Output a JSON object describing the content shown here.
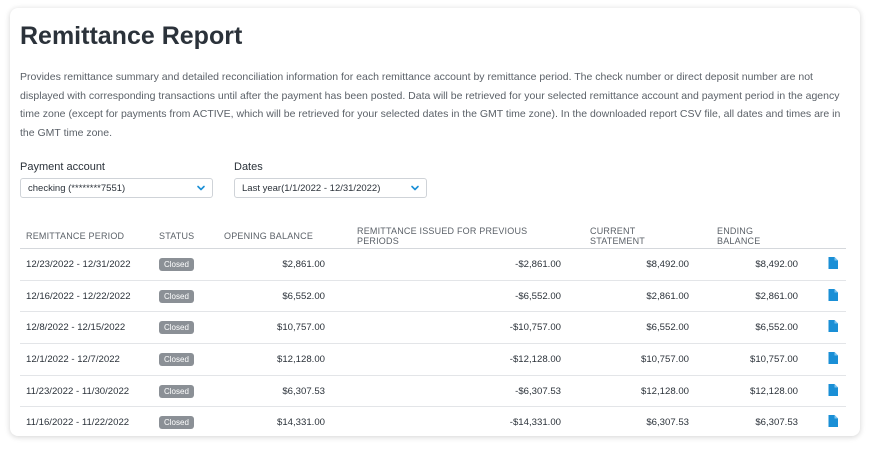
{
  "page": {
    "title": "Remittance Report",
    "description": "Provides remittance summary and detailed reconciliation information for each remittance account by remittance period. The check number or direct deposit number are not displayed with corresponding transactions until after the payment has been posted. Data will be retrieved for your selected remittance account and payment period in the agency time zone (except for payments from ACTIVE, which will be retrieved for your selected dates in the GMT time zone). In the downloaded report CSV file, all dates and times are in the GMT time zone."
  },
  "filters": {
    "payment_account": {
      "label": "Payment account",
      "value": "checking (********7551)"
    },
    "dates": {
      "label": "Dates",
      "value": "Last year(1/1/2022 - 12/31/2022)"
    }
  },
  "table": {
    "headers": {
      "period": "REMITTANCE PERIOD",
      "status": "STATUS",
      "opening": "OPENING BALANCE",
      "previous": "REMITTANCE ISSUED FOR PREVIOUS PERIODS",
      "current": "CURRENT STATEMENT",
      "ending": "ENDING BALANCE"
    },
    "rows": [
      {
        "period": "12/23/2022 - 12/31/2022",
        "status": "Closed",
        "opening": "$2,861.00",
        "previous": "-$2,861.00",
        "current": "$8,492.00",
        "ending": "$8,492.00",
        "icon": "document-icon"
      },
      {
        "period": "12/16/2022 - 12/22/2022",
        "status": "Closed",
        "opening": "$6,552.00",
        "previous": "-$6,552.00",
        "current": "$2,861.00",
        "ending": "$2,861.00",
        "icon": "document-icon"
      },
      {
        "period": "12/8/2022 - 12/15/2022",
        "status": "Closed",
        "opening": "$10,757.00",
        "previous": "-$10,757.00",
        "current": "$6,552.00",
        "ending": "$6,552.00",
        "icon": "document-icon"
      },
      {
        "period": "12/1/2022 - 12/7/2022",
        "status": "Closed",
        "opening": "$12,128.00",
        "previous": "-$12,128.00",
        "current": "$10,757.00",
        "ending": "$10,757.00",
        "icon": "document-icon"
      },
      {
        "period": "11/23/2022 - 11/30/2022",
        "status": "Closed",
        "opening": "$6,307.53",
        "previous": "-$6,307.53",
        "current": "$12,128.00",
        "ending": "$12,128.00",
        "icon": "document-icon"
      },
      {
        "period": "11/16/2022 - 11/22/2022",
        "status": "Closed",
        "opening": "$14,331.00",
        "previous": "-$14,331.00",
        "current": "$6,307.53",
        "ending": "$6,307.53",
        "icon": "document-icon"
      }
    ]
  },
  "colors": {
    "accent": "#1a8fd6",
    "badge": "#8b9096",
    "text": "#2b323a"
  }
}
